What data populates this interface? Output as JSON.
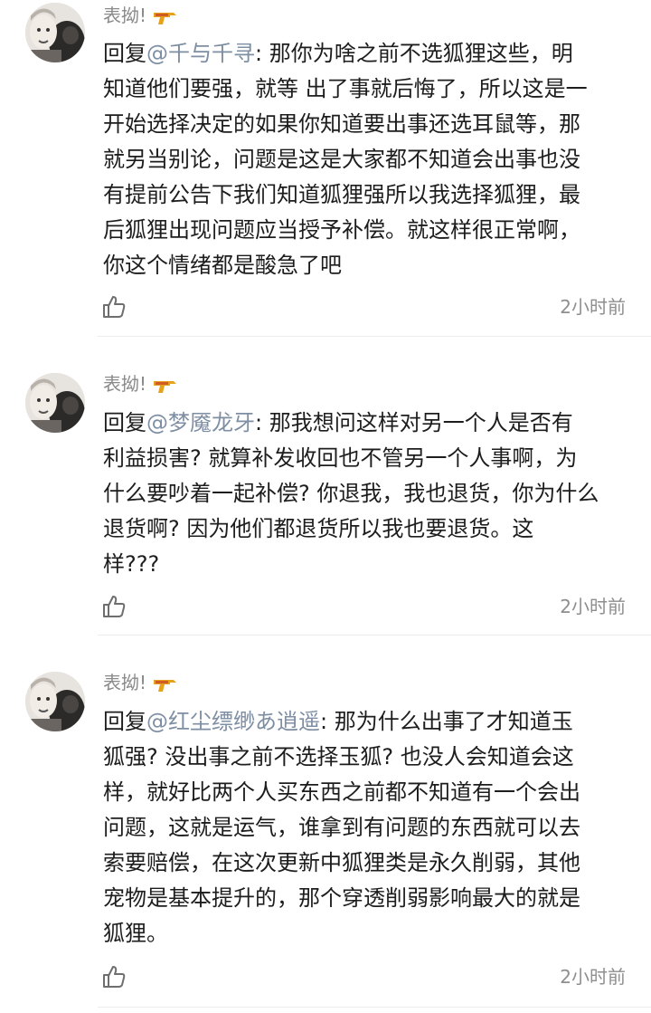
{
  "comments": [
    {
      "username": "表拗!",
      "reply_prefix": "回复",
      "mention": "@千与千寻",
      "text": ": 那你为啥之前不选狐狸这些，明\n知道他们要强，就等 出了事就后悔了，所以这是一\n开始选择决定的如果你知道要出事还选耳鼠等，那\n就另当别论，问题是这是大家都不知道会出事也没\n有提前公告下我们知道狐狸强所以我选择狐狸，最\n后狐狸出现问题应当授予补偿。就这样很正常啊，\n你这个情绪都是酸急了吧",
      "time": "2小时前"
    },
    {
      "username": "表拗!",
      "reply_prefix": "回复",
      "mention": "@梦魇龙牙",
      "text": ": 那我想问这样对另一个人是否有\n利益损害? 就算补发收回也不管另一个人事啊，为\n什么要吵着一起补偿? 你退我，我也退货，你为什么\n退货啊? 因为他们都退货所以我也要退货。这\n样???",
      "time": "2小时前"
    },
    {
      "username": "表拗!",
      "reply_prefix": "回复",
      "mention": "@红尘缥缈あ逍遥",
      "text": ": 那为什么出事了才知道玉\n狐强? 没出事之前不选择玉狐? 也没人会知道会这\n样，就好比两个人买东西之前都不知道有一个会出\n问题，这就是运气，谁拿到有问题的东西就可以去\n索要赔偿，在这次更新中狐狸类是永久削弱，其他\n宠物是基本提升的，那个穿透削弱影响最大的就是\n狐狸。",
      "time": "2小时前"
    }
  ],
  "icons": {
    "badge": "water-gun-icon",
    "like": "thumbs-up-icon"
  },
  "colors": {
    "mention": "#7e8ea3",
    "username": "#8a8a8a",
    "text": "#1d1d1d",
    "time": "#8e8e8e",
    "divider": "#ececec"
  }
}
